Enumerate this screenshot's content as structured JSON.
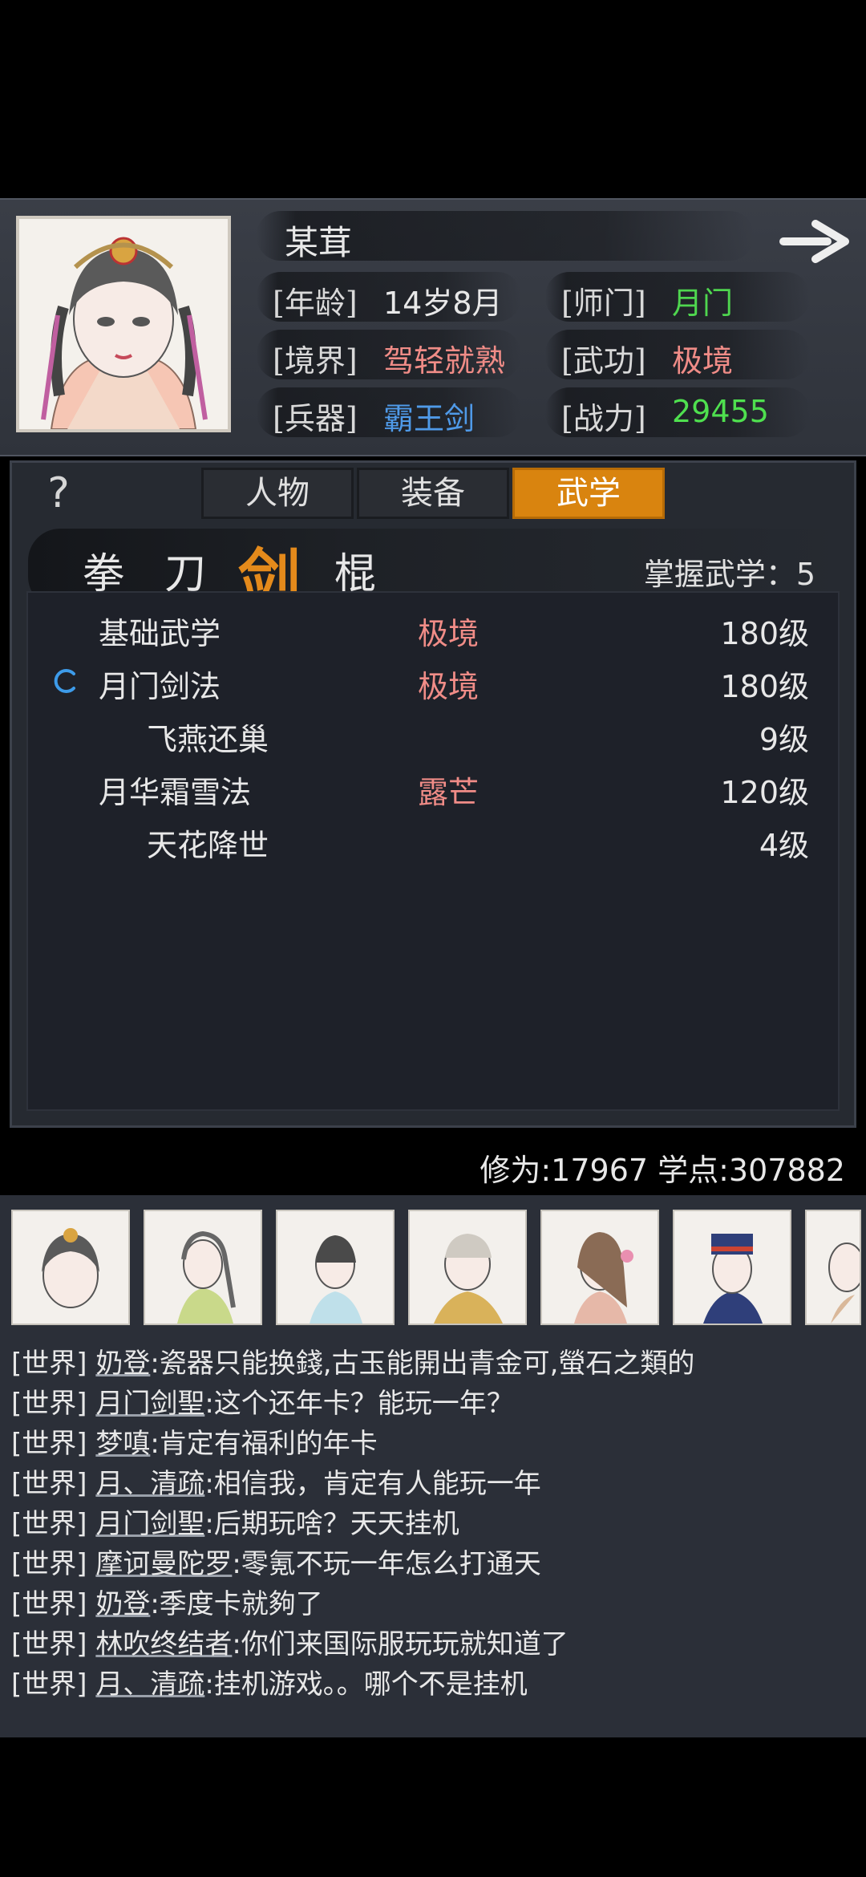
{
  "character": {
    "name": "某茸",
    "age_label": "[年龄]",
    "age": "14岁8月",
    "sect_label": "[师门]",
    "sect": "月门",
    "realm_label": "[境界]",
    "realm": "驾轻就熟",
    "skill_label": "[武功]",
    "skill": "极境",
    "weapon_label": "[兵器]",
    "weapon": "霸王剑",
    "power_label": "[战力]",
    "power": "29455"
  },
  "tabs": [
    {
      "label": "人物",
      "active": false
    },
    {
      "label": "装备",
      "active": false
    },
    {
      "label": "武学",
      "active": true
    }
  ],
  "weapon_types": [
    {
      "label": "拳",
      "active": false
    },
    {
      "label": "刀",
      "active": false
    },
    {
      "label": "剑",
      "active": true
    },
    {
      "label": "棍",
      "active": false
    }
  ],
  "mastery": "掌握武学：5",
  "skills": [
    {
      "name": "基础武学",
      "rank": "极境",
      "level": "180级",
      "indent": false,
      "active": false
    },
    {
      "name": "月门剑法",
      "rank": "极境",
      "level": "180级",
      "indent": false,
      "active": true
    },
    {
      "name": "飞燕还巢",
      "rank": "",
      "level": "9级",
      "indent": true,
      "active": false
    },
    {
      "name": "月华霜雪法",
      "rank": "露芒",
      "level": "120级",
      "indent": false,
      "active": false
    },
    {
      "name": "天花降世",
      "rank": "",
      "level": "4级",
      "indent": true,
      "active": false
    }
  ],
  "stats": "修为:17967  学点:307882",
  "chat": [
    {
      "channel": "[世界]",
      "user": "奶登",
      "text": ":瓷器只能换錢,古玉能開出青金可,螢石之類的"
    },
    {
      "channel": "[世界]",
      "user": "月门剑聖",
      "text": ":这个还年卡？能玩一年？"
    },
    {
      "channel": "[世界]",
      "user": "梦嗔",
      "text": ":肯定有福利的年卡"
    },
    {
      "channel": "[世界]",
      "user": "月、清疏",
      "text": ":相信我，肯定有人能玩一年"
    },
    {
      "channel": "[世界]",
      "user": "月门剑聖",
      "text": ":后期玩啥？天天挂机"
    },
    {
      "channel": "[世界]",
      "user": "摩诃曼陀罗",
      "text": ":零氪不玩一年怎么打通天"
    },
    {
      "channel": "[世界]",
      "user": "奶登",
      "text": ":季度卡就夠了"
    },
    {
      "channel": "[世界]",
      "user": "林吹终结者",
      "text": ":你们来国际服玩玩就知道了"
    },
    {
      "channel": "[世界]",
      "user": "月、清疏",
      "text": ":挂机游戏。。哪个不是挂机"
    }
  ],
  "colors": {
    "accent": "#d9840f",
    "rank_red": "#f08c87",
    "sect_green": "#4fd64f",
    "weapon_blue": "#4f9ae8",
    "power_green": "#4fe04f"
  }
}
